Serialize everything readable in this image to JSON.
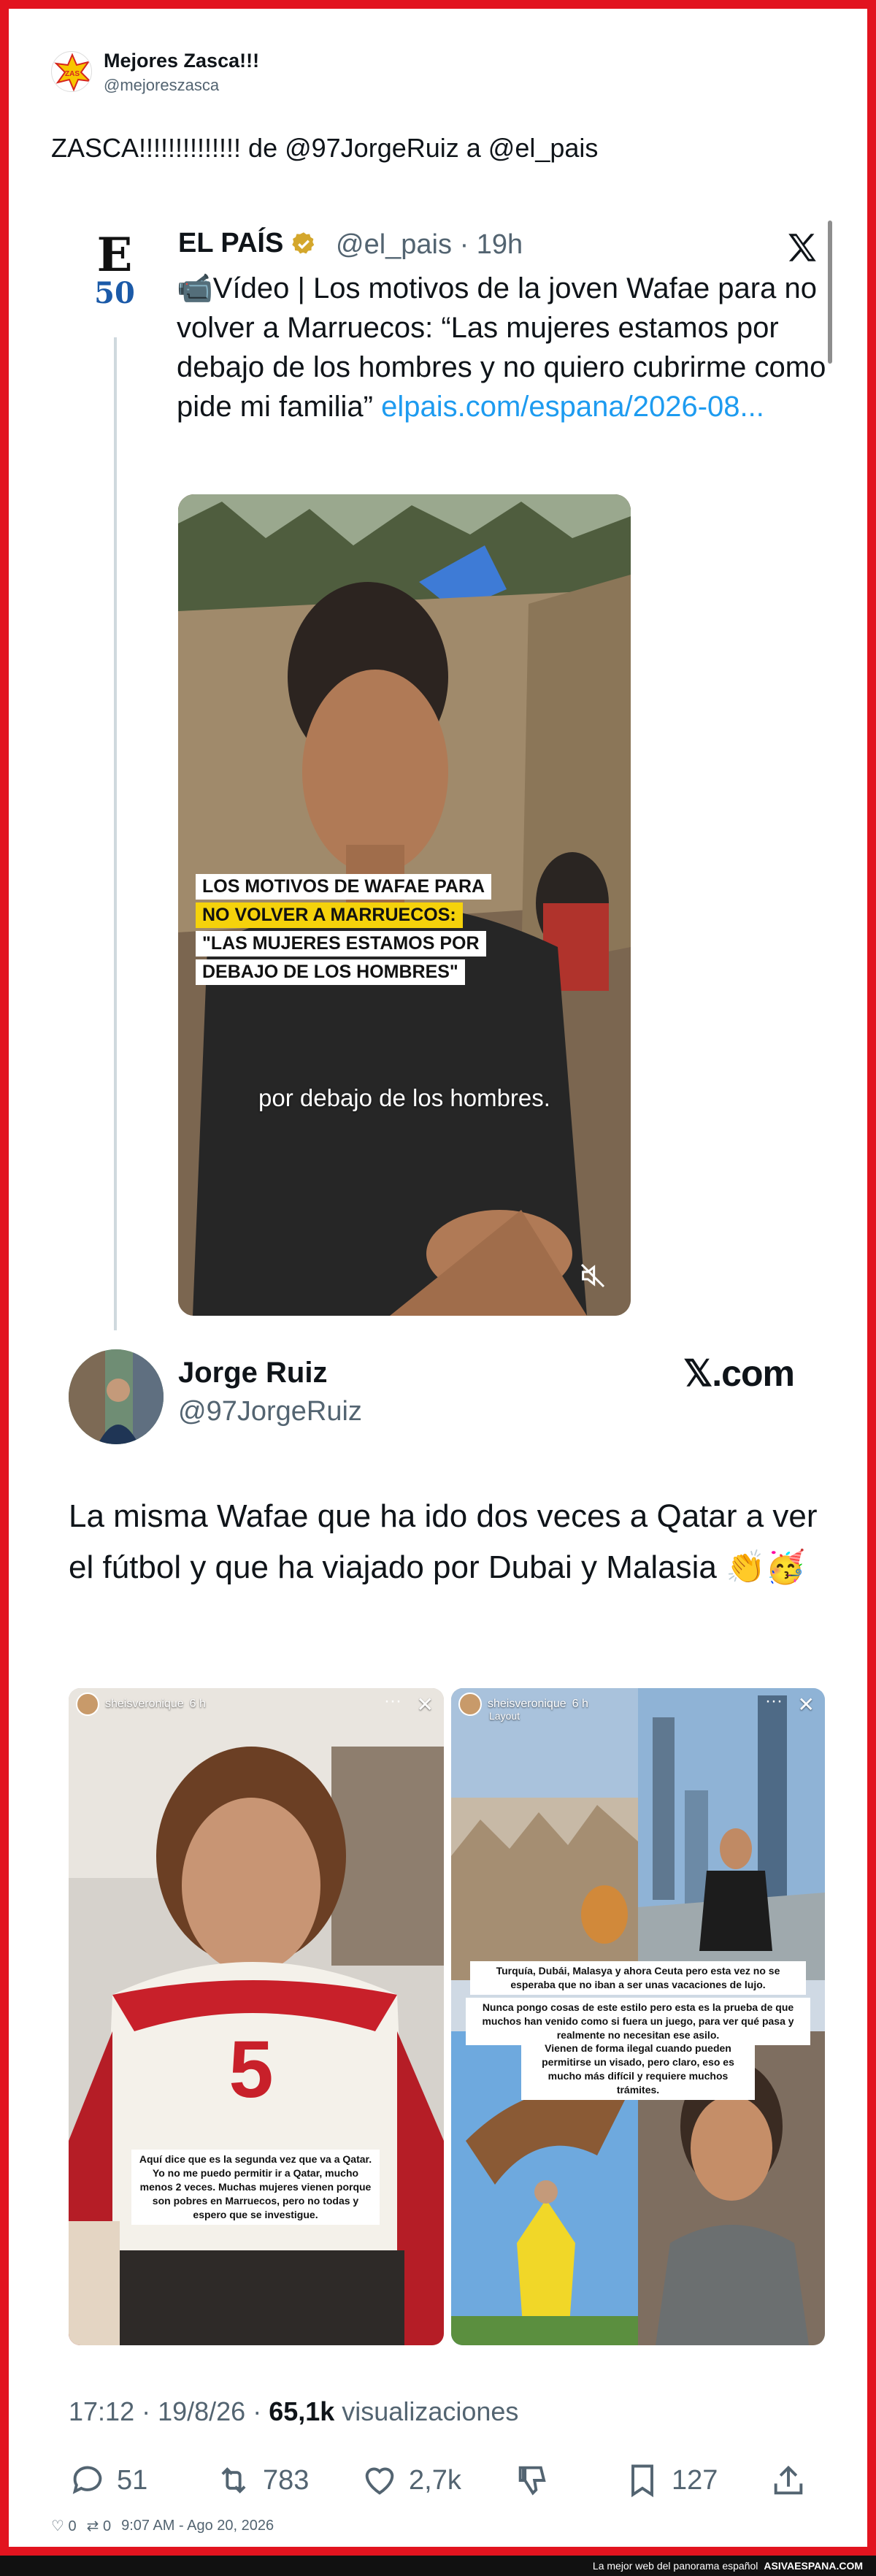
{
  "header": {
    "user_name": "Mejores Zasca!!!",
    "user_handle": "@mejoreszasca",
    "intro_text": "ZASCA!!!!!!!!!!!!!! de @97JorgeRuiz a @el_pais"
  },
  "quoted_tweet": {
    "name": "EL PAÍS",
    "handle": "@el_pais",
    "time": "· 19h",
    "avatar_letter": "E",
    "avatar_number": "50",
    "text": "📹Vídeo | Los motivos de la joven Wafae para no volver a Marruecos: “Las mujeres estamos por debajo de los hombres y no quiero cubrirme como pide mi familia” ",
    "link_text": "elpais.com/espana/2026-08...",
    "video_caption": {
      "line1": "LOS MOTIVOS DE WAFAE PARA",
      "line2": "NO VOLVER A MARRUECOS:",
      "line3": "\"LAS MUJERES ESTAMOS POR",
      "line4": "DEBAJO DE LOS HOMBRES\""
    },
    "subtitle": "por debajo de los hombres."
  },
  "embedded_tweet": {
    "name": "Jorge Ruiz",
    "handle": "@97JorgeRuiz",
    "brand": "𝕏.com",
    "text": "La misma Wafae que ha ido dos veces a Qatar a ver el fútbol y que ha viajado por Dubai y Malasia 👏🥳",
    "left_image": {
      "story_user": "sheisveronique",
      "story_time": "6 h",
      "shirt_number": "5",
      "note": "Aquí dice que es la segunda vez que va a Qatar. Yo no me puedo permitir ir a Qatar, mucho menos 2 veces. Muchas mujeres vienen porque son pobres en Marruecos, pero no todas y espero que se investigue."
    },
    "right_image": {
      "story_user": "sheisveronique",
      "story_time": "6 h",
      "story_sub": "Layout",
      "note1": "Turquía, Dubái, Malasya y ahora Ceuta pero esta vez no se esperaba que no iban a ser unas vacaciones de lujo.",
      "note2": "Nunca pongo cosas de este estilo pero esta es la prueba de que muchos han venido como si fuera un juego, para ver qué pasa y realmente no necesitan ese asilo.",
      "note3": "Vienen de forma ilegal cuando pueden permitirse un visado, pero claro, eso es mucho más difícil y requiere muchos trámites."
    }
  },
  "stats": {
    "time": "17:12 · 19/8/26 · ",
    "views_count": "65,1k",
    "views_label": " visualizaciones",
    "replies": "51",
    "retweets": "783",
    "likes": "2,7k",
    "bookmarks": "127"
  },
  "mini_bar": {
    "likes": "0",
    "retweets": "0",
    "timestamp": "9:07 AM - Ago 20, 2026"
  },
  "footer": {
    "tagline": "La mejor web del panorama español",
    "site": "ASIVAESPANA.COM"
  },
  "colors": {
    "frame": "#e2141f",
    "link": "#1d9bf0",
    "muted": "#536471",
    "verified": "#d4a72c"
  }
}
